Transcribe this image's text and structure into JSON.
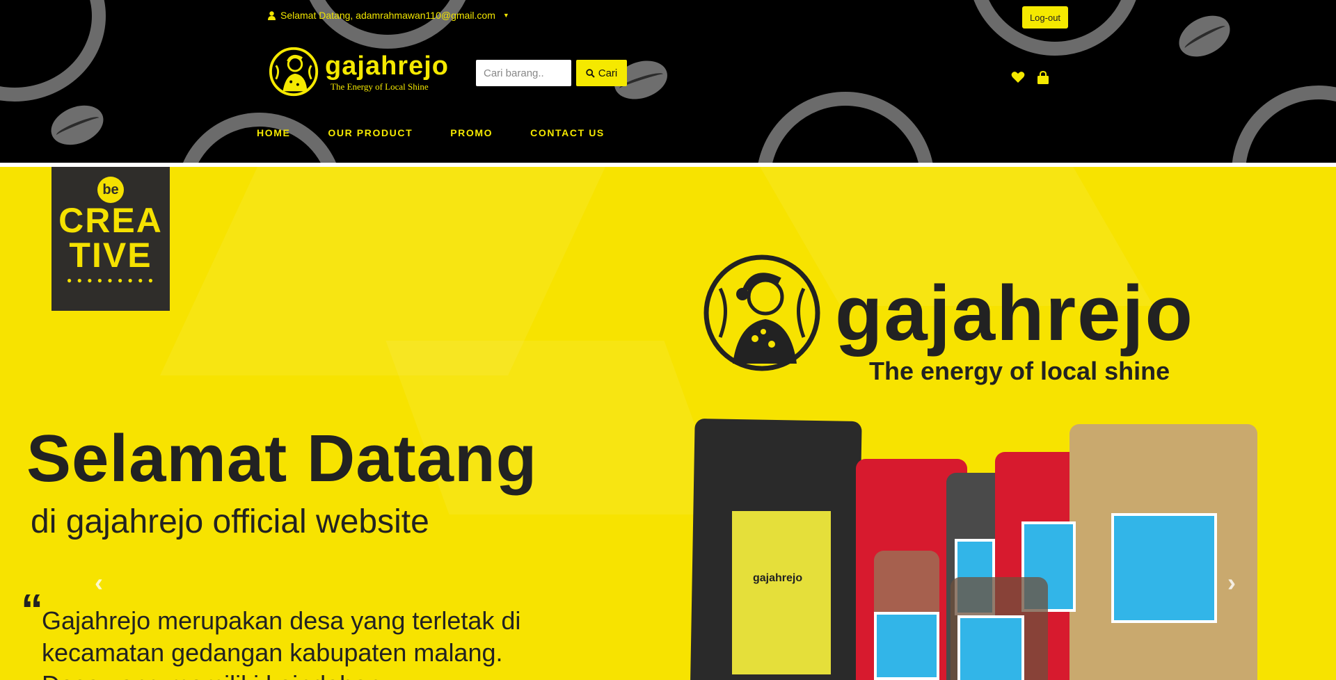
{
  "header": {
    "greeting": "Selamat Datang, adamrahmawan110@gmail.com",
    "logout_label": "Log-out",
    "brand": {
      "name": "gajahrejo",
      "tagline": "The Energy of Local Shine"
    },
    "search": {
      "placeholder": "Cari barang..",
      "button_label": "Cari"
    },
    "icons": [
      "user-icon",
      "caret-down-icon",
      "search-icon",
      "heart-icon",
      "shopping-bag-icon"
    ],
    "nav": [
      {
        "label": "HOME"
      },
      {
        "label": "OUR PRODUCT"
      },
      {
        "label": "PROMO"
      },
      {
        "label": "CONTACT US"
      }
    ]
  },
  "hero": {
    "badge": {
      "top": "be",
      "middle": "CREA",
      "bottom": "TIVE"
    },
    "brand_name": "gajahrejo",
    "brand_tagline": "The energy of local shine",
    "title": "Selamat Datang",
    "subtitle": "di gajahrejo official website",
    "quote_mark": "“",
    "description": "Gajahrejo merupakan desa yang terletak di kecamatan gedangan kabupaten malang. Desa yang memiliki keindahan",
    "package_label": "gajahrejo",
    "carousel": {
      "prev": "‹",
      "next": "›"
    }
  },
  "colors": {
    "header_bg": "#000000",
    "accent_yellow": "#f5e900",
    "hero_bg": "#f7e300",
    "ring_gray": "#6b6b6b"
  }
}
